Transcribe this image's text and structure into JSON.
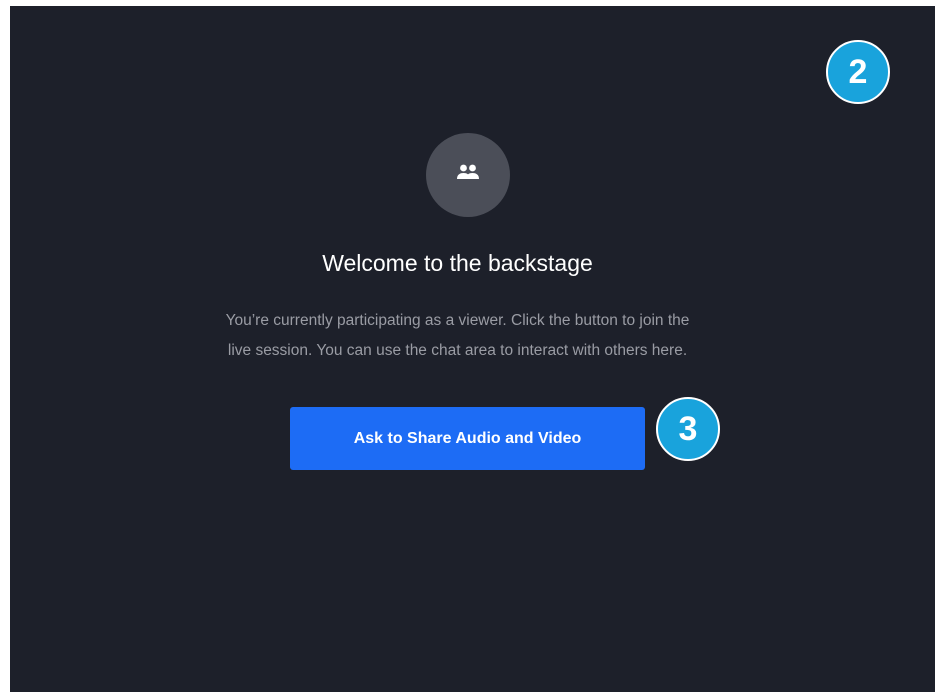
{
  "welcome": {
    "title": "Welcome to the backstage",
    "description_line1": "You’re currently participating as a viewer. Click the button to join the",
    "description_line2": "live session. You can use the chat area to interact with others here.",
    "icon": "people-icon"
  },
  "actions": {
    "share_button_label": "Ask to Share Audio and Video"
  },
  "annotations": {
    "callout_2": "2",
    "callout_3": "3"
  },
  "colors": {
    "background": "#1d202a",
    "button": "#1d6cf5",
    "callout": "#19a3dc",
    "avatar": "#4b4e58"
  }
}
